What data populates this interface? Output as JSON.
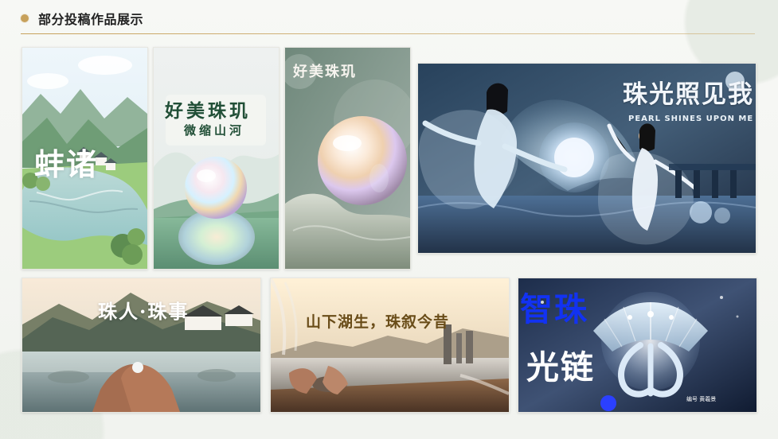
{
  "page": {
    "title": "部分投稿作品展示"
  },
  "works": [
    {
      "title": "蚌诸"
    },
    {
      "title": "好美珠玑",
      "subtitle": "微缩山河"
    },
    {
      "title": "好美珠玑"
    },
    {
      "title": "珠光照见我",
      "subtitle": "PEARL SHINES UPON ME"
    },
    {
      "title": "珠人·珠事"
    },
    {
      "title": "山下湖生，珠叙今昔"
    },
    {
      "title_part1": "智珠",
      "title_part2": "光链",
      "caption": "编号 黄羲景"
    }
  ]
}
